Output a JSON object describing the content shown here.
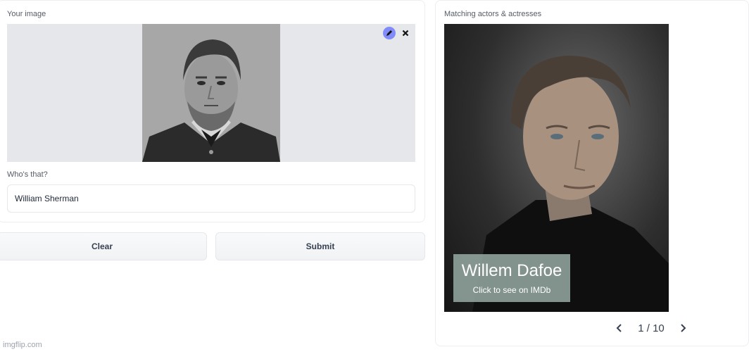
{
  "input_section": {
    "image_label": "Your image",
    "name_label": "Who's that?",
    "name_value": "William Sherman"
  },
  "actions": {
    "clear_label": "Clear",
    "submit_label": "Submit"
  },
  "output_section": {
    "label": "Matching actors & actresses",
    "result": {
      "name": "Willem Dafoe",
      "link_text": "Click to see on IMDb"
    },
    "pager": {
      "text": "1 / 10"
    }
  },
  "watermark": "imgflip.com",
  "colors": {
    "edit_accent": "#818cf8",
    "caption_bg": "#96aaa5"
  },
  "icons": {
    "edit": "pencil-icon",
    "close": "close-icon",
    "prev": "chevron-left-icon",
    "next": "chevron-right-icon"
  }
}
